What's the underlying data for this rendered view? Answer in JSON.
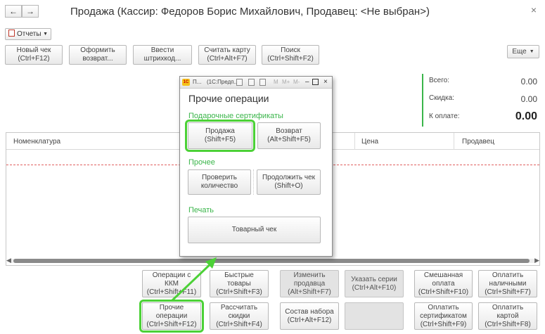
{
  "window": {
    "title": "Продажа (Кассир: Федоров Борис Михайлович, Продавец: <Не выбран>)",
    "back_icon": "←",
    "forward_icon": "→",
    "close_icon": "×"
  },
  "reports_menu": {
    "label": "Отчеты"
  },
  "toolbar": {
    "buttons": [
      {
        "line1": "Новый чек",
        "line2": "(Ctrl+F12)"
      },
      {
        "line1": "Оформить",
        "line2": "возврат..."
      },
      {
        "line1": "Ввести",
        "line2": "штрихкод..."
      },
      {
        "line1": "Считать карту",
        "line2": "(Ctrl+Alt+F7)"
      },
      {
        "line1": "Поиск",
        "line2": "(Ctrl+Shift+F2)"
      }
    ],
    "more_label": "Еще"
  },
  "totals": {
    "total_label": "Всего:",
    "total_value": "0.00",
    "discount_label": "Скидка:",
    "discount_value": "0.00",
    "due_label": "К оплате:",
    "due_value": "0.00"
  },
  "grid": {
    "columns": [
      "Номенклатура",
      "Цена",
      "Продавец"
    ]
  },
  "dialog": {
    "title_short": "П...",
    "title_app": "(1С:Предп...",
    "logo": "1С",
    "m_buttons": [
      "M",
      "M+",
      "M-"
    ],
    "heading": "Прочие операции",
    "sections": {
      "gift": "Подарочные сертификаты",
      "other": "Прочее",
      "print": "Печать"
    },
    "buttons": {
      "sale": {
        "line1": "Продажа",
        "line2": "(Shift+F5)"
      },
      "return": {
        "line1": "Возврат",
        "line2": "(Alt+Shift+F5)"
      },
      "check_qty": {
        "line1": "Проверить",
        "line2": "количество"
      },
      "continue_check": {
        "line1": "Продолжить чек",
        "line2": "(Shift+O)"
      },
      "goods_receipt": {
        "line1": "Товарный чек"
      }
    }
  },
  "bottom_buttons": {
    "row1": [
      {
        "line1": "Операции с",
        "line2": "ККМ",
        "line3": "(Ctrl+Shift+F11)"
      },
      {
        "line1": "Быстрые",
        "line2": "товары",
        "line3": "(Ctrl+Shift+F3)"
      },
      {
        "line1": "Изменить",
        "line2": "продавца",
        "line3": "(Alt+Shift+F7)"
      },
      {
        "line1": "Указать серии",
        "line2": "(Ctrl+Alt+F10)"
      },
      {
        "line1": "Смешанная",
        "line2": "оплата",
        "line3": "(Ctrl+Shift+F10)"
      },
      {
        "line1": "Оплатить",
        "line2": "наличными",
        "line3": "(Ctrl+Shift+F7)"
      }
    ],
    "row2": [
      {
        "line1": "Прочие",
        "line2": "операции",
        "line3": "(Ctrl+Shift+F12)"
      },
      {
        "line1": "Рассчитать",
        "line2": "скидки",
        "line3": "(Ctrl+Shift+F4)"
      },
      {
        "line1": "Состав набора",
        "line2": "(Ctrl+Alt+F12)"
      },
      {
        "line1": ""
      },
      {
        "line1": "Оплатить",
        "line2": "сертификатом",
        "line3": "(Ctrl+Shift+F9)"
      },
      {
        "line1": "Оплатить",
        "line2": "картой",
        "line3": "(Ctrl+Shift+F8)"
      }
    ]
  },
  "colors": {
    "accent_green": "#3ab54a",
    "highlight_green": "#4cd137"
  }
}
